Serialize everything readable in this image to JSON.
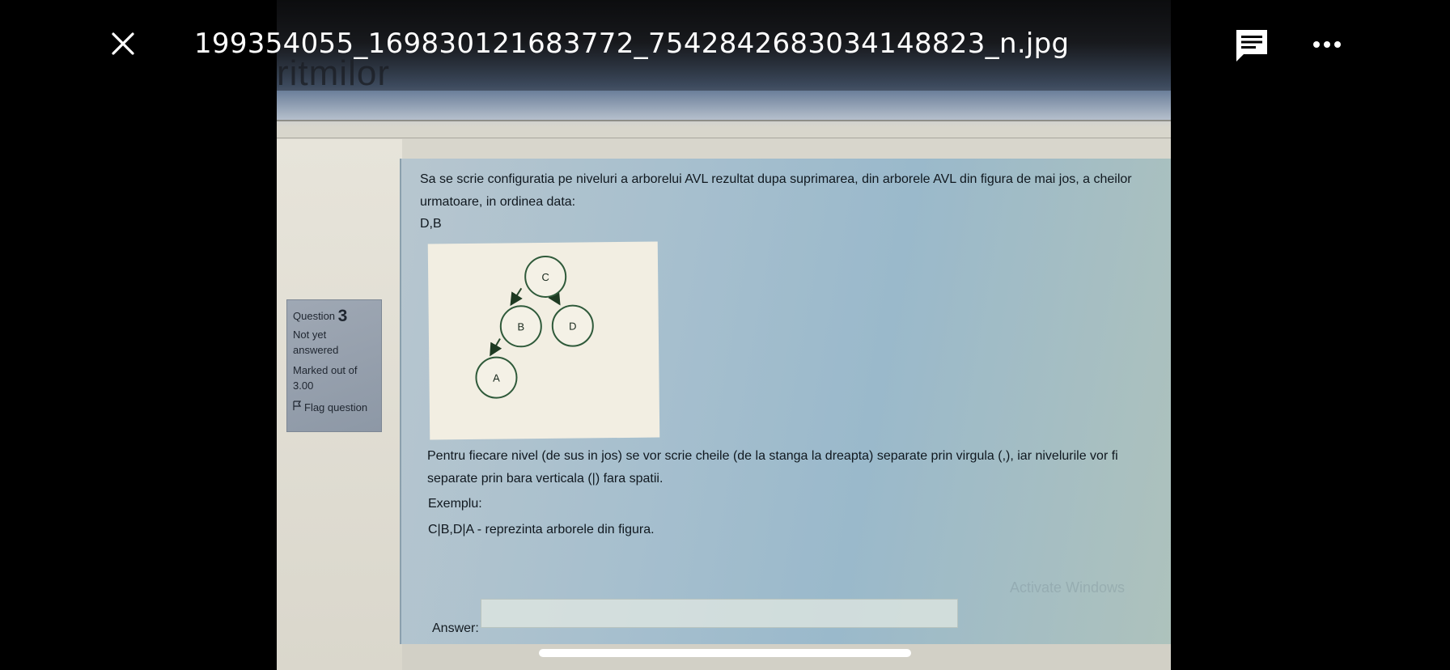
{
  "viewer": {
    "filename": "199354055_169830121683772_7542842683034148823_n.jpg",
    "close_icon": "close-icon",
    "comment_icon": "comment-icon",
    "more_icon": "more-options-icon"
  },
  "photo": {
    "background_heading": "ritmilor",
    "question_info": {
      "label": "Question",
      "number": "3",
      "status": "Not yet answered",
      "marked": "Marked out of 3.00",
      "flag_label": "Flag question"
    },
    "question": {
      "text": "Sa se scrie configuratia pe niveluri a arborelui AVL rezultat dupa suprimarea, din arborele AVL din figura de mai jos, a cheilor urmatoare, in ordinea data:",
      "keys": "D,B",
      "instructions": "Pentru fiecare nivel (de sus in jos) se vor scrie cheile (de la stanga la dreapta) separate prin virgula (,), iar nivelurile vor fi separate prin bara verticala (|) fara spatii.",
      "example_label": "Exemplu:",
      "example_text": "C|B,D|A - reprezinta arborele din figura.",
      "answer_label": "Answer:",
      "answer_value": "",
      "watermark": "Activate Windows"
    },
    "tree": {
      "nodes": [
        "C",
        "B",
        "D",
        "A"
      ],
      "edges": [
        [
          "C",
          "B"
        ],
        [
          "C",
          "D"
        ],
        [
          "B",
          "A"
        ]
      ]
    }
  },
  "colors": {
    "panel_accent": "#9ab9cb",
    "overlay_text": "#ffffff"
  }
}
